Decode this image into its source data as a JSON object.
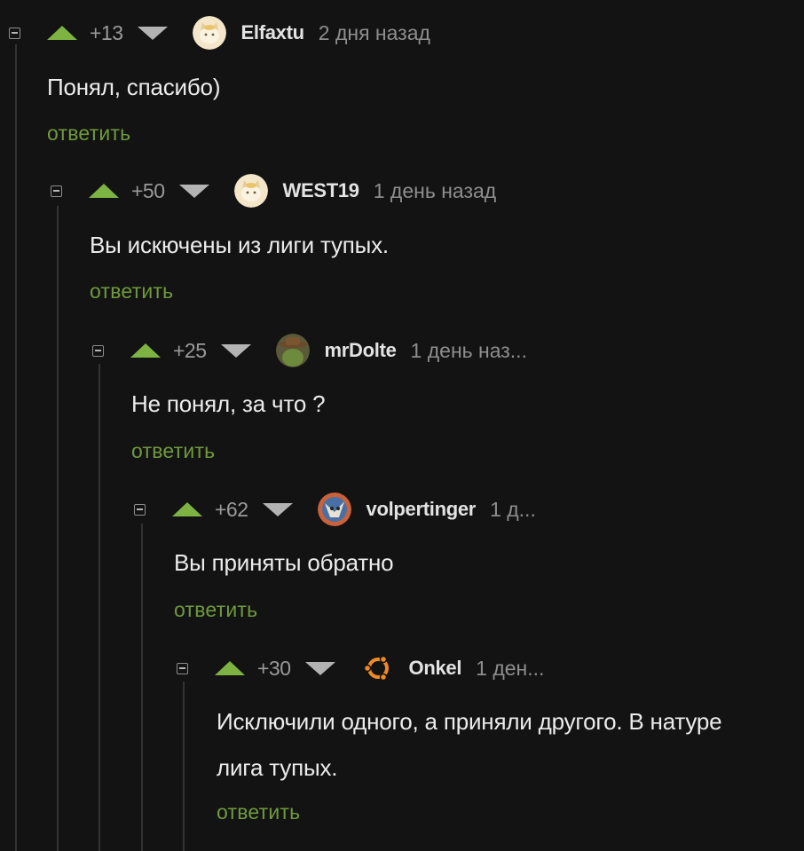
{
  "comments": [
    {
      "rating": "+13",
      "author": "Elfaxtu",
      "time": "2 дня назад",
      "text_lines": [
        "Понял, спасибо)"
      ],
      "reply_label": "ответить",
      "avatar_icon": "cat-avatar-icon"
    },
    {
      "rating": "+50",
      "author": "WEST19",
      "time": "1 день назад",
      "text_lines": [
        "Вы искючены из лиги тупых."
      ],
      "reply_label": "ответить",
      "avatar_icon": "cat-avatar-icon"
    },
    {
      "rating": "+25",
      "author": "mrDolte",
      "time": "1 день наз...",
      "text_lines": [
        "Не понял, за что ?"
      ],
      "reply_label": "ответить",
      "avatar_icon": "cowboy-avatar-icon"
    },
    {
      "rating": "+62",
      "author": "volpertinger",
      "time": "1 д...",
      "text_lines": [
        "Вы приняты обратно"
      ],
      "reply_label": "ответить",
      "avatar_icon": "creature-avatar-icon"
    },
    {
      "rating": "+30",
      "author": "Onkel",
      "time": "1 ден...",
      "text_lines": [
        "Исключили одного, а приняли другого. В натуре",
        "лига тупых."
      ],
      "reply_label": "ответить",
      "avatar_icon": "ubuntu-logo-avatar-icon"
    }
  ],
  "colors": {
    "background": "#131313",
    "upvote": "#7cb342",
    "reply_link": "#6f9a3c",
    "thread_line": "#333333"
  }
}
